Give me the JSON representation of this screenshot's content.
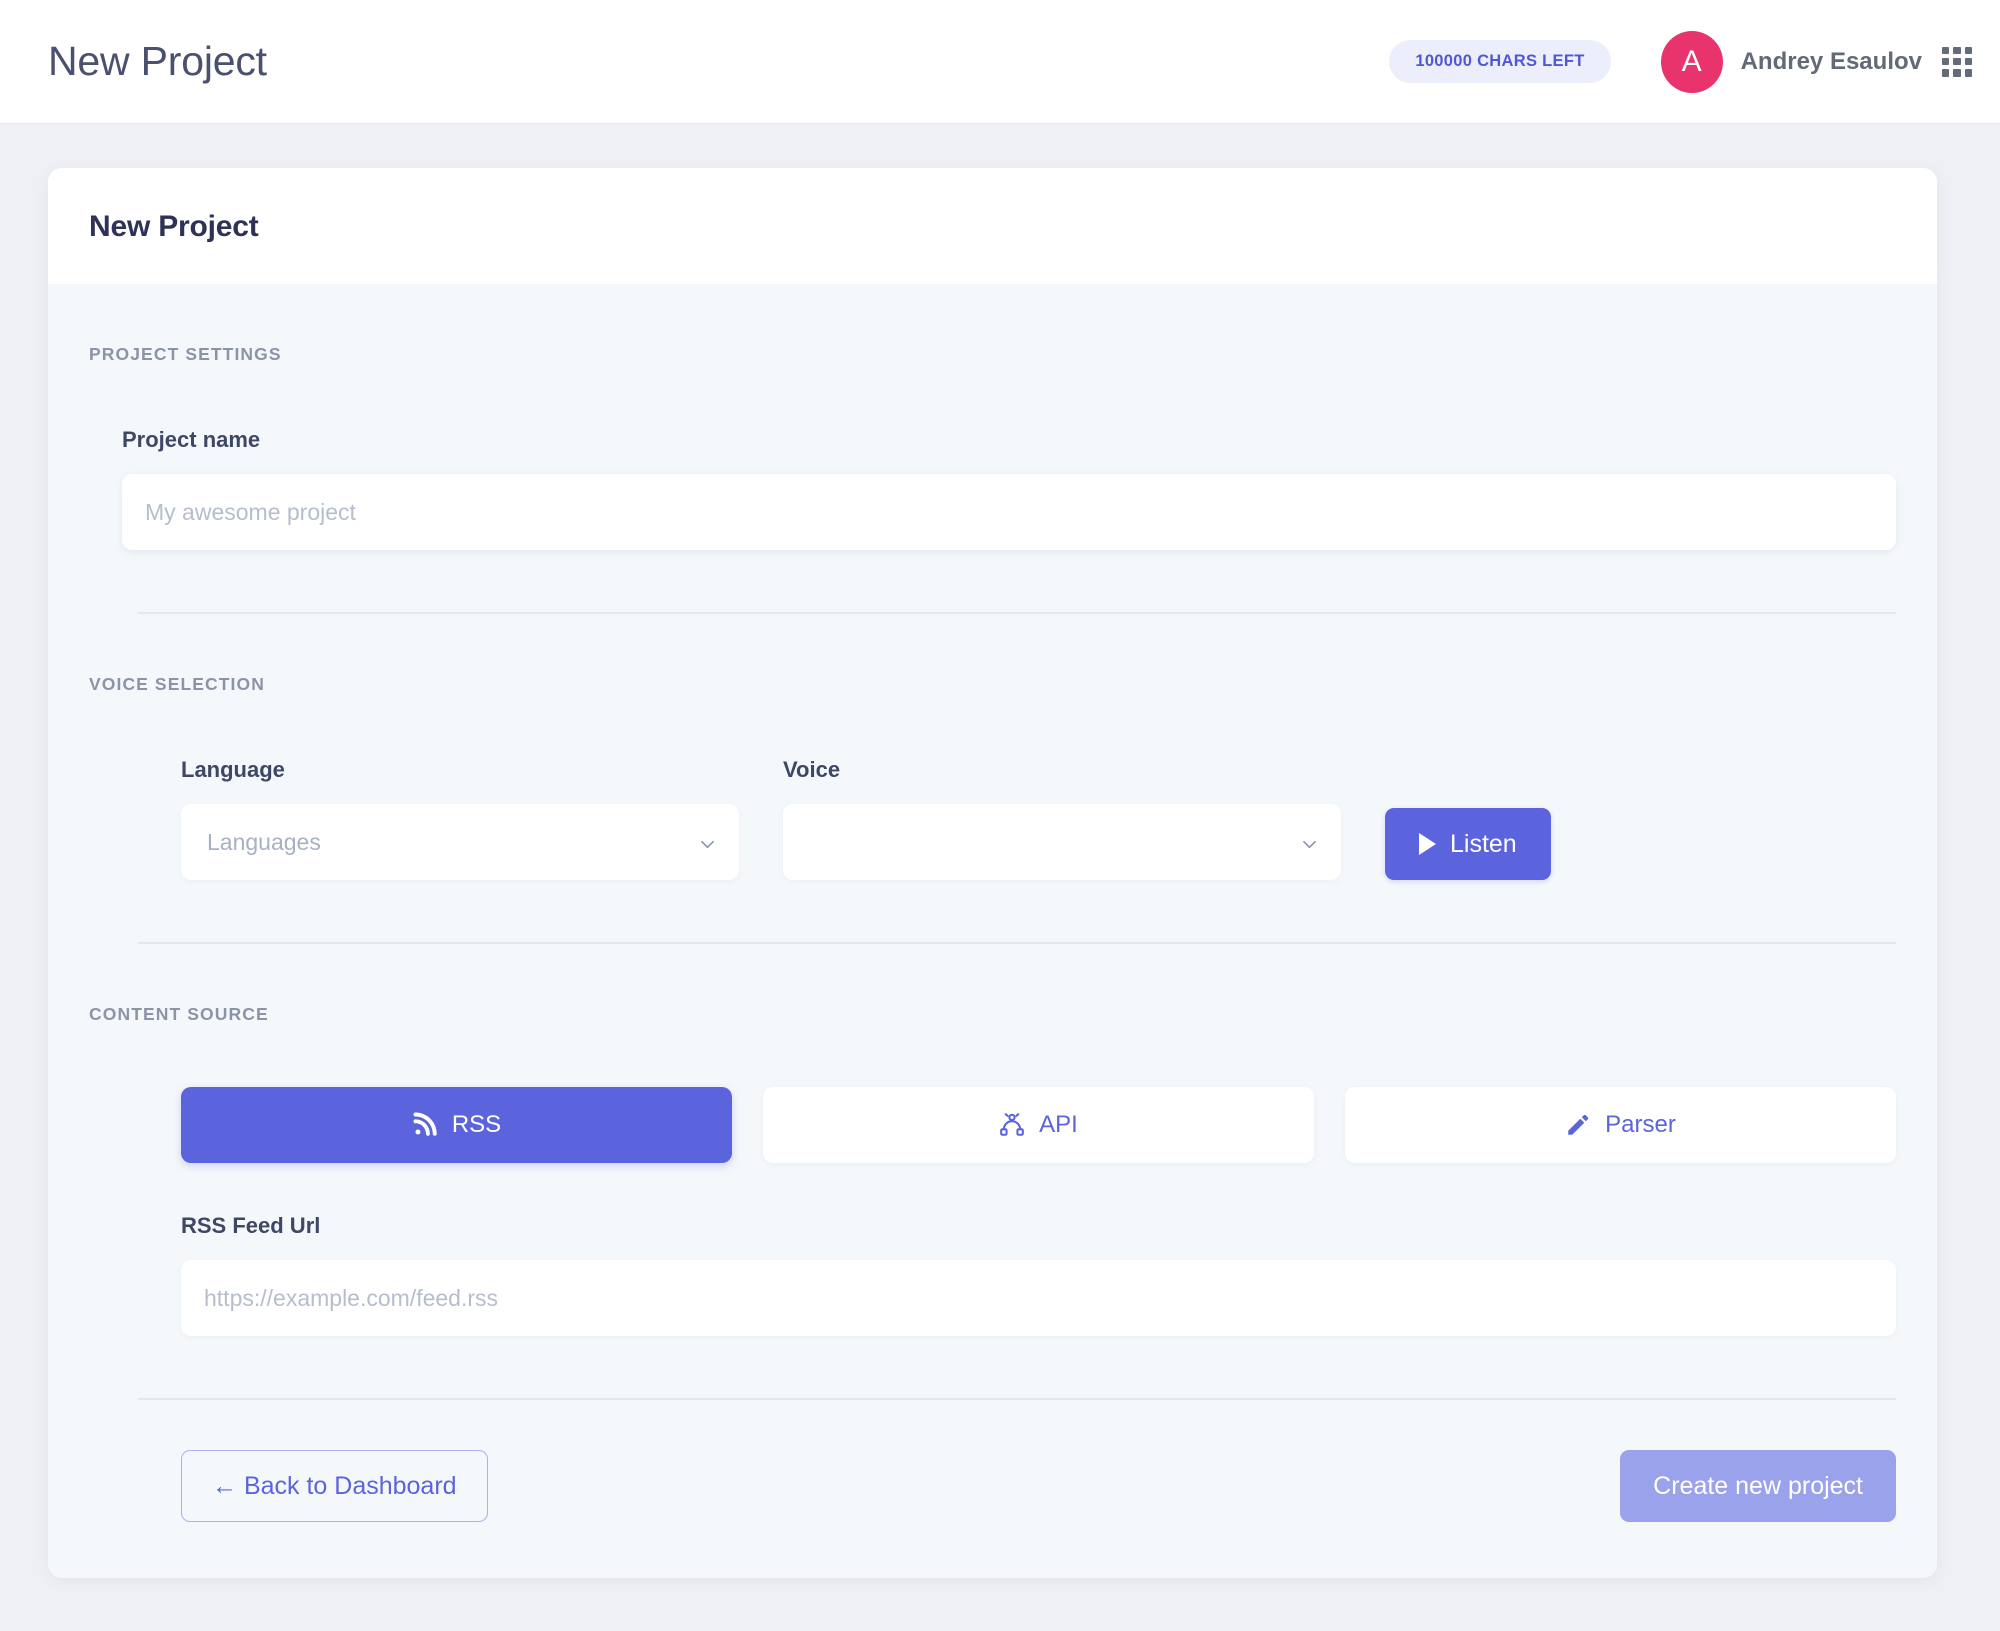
{
  "topbar": {
    "title": "New Project",
    "chars_badge": "100000 CHARS LEFT",
    "avatar_initial": "A",
    "user_name": "Andrey Esaulov",
    "apps_icon": "grid-apps-icon"
  },
  "card": {
    "title": "New Project",
    "sections": {
      "project_settings": {
        "label": "PROJECT SETTINGS",
        "project_name_label": "Project name",
        "project_name_value": "",
        "project_name_placeholder": "My awesome project"
      },
      "voice_selection": {
        "label": "VOICE SELECTION",
        "language_label": "Language",
        "language_value": "Languages",
        "voice_label": "Voice",
        "voice_value": "",
        "listen_label": "Listen"
      },
      "content_source": {
        "label": "CONTENT SOURCE",
        "tabs": [
          {
            "label": "RSS",
            "icon": "rss-icon",
            "active": true
          },
          {
            "label": "API",
            "icon": "api-node-icon",
            "active": false
          },
          {
            "label": "Parser",
            "icon": "pencil-icon",
            "active": false
          }
        ],
        "feed_url_label": "RSS Feed Url",
        "feed_url_value": "",
        "feed_url_placeholder": "https://example.com/feed.rss"
      }
    },
    "footer": {
      "back_label": "← Back to Dashboard",
      "create_label": "Create new project"
    }
  },
  "colors": {
    "accent": "#5b64dd",
    "accent_muted": "#9aa2ec",
    "avatar": "#e8336d",
    "badge_bg": "#eceefb",
    "badge_text": "#4f57d6",
    "page_bg": "#eef0f5",
    "card_body_bg": "#f5f8fb"
  }
}
